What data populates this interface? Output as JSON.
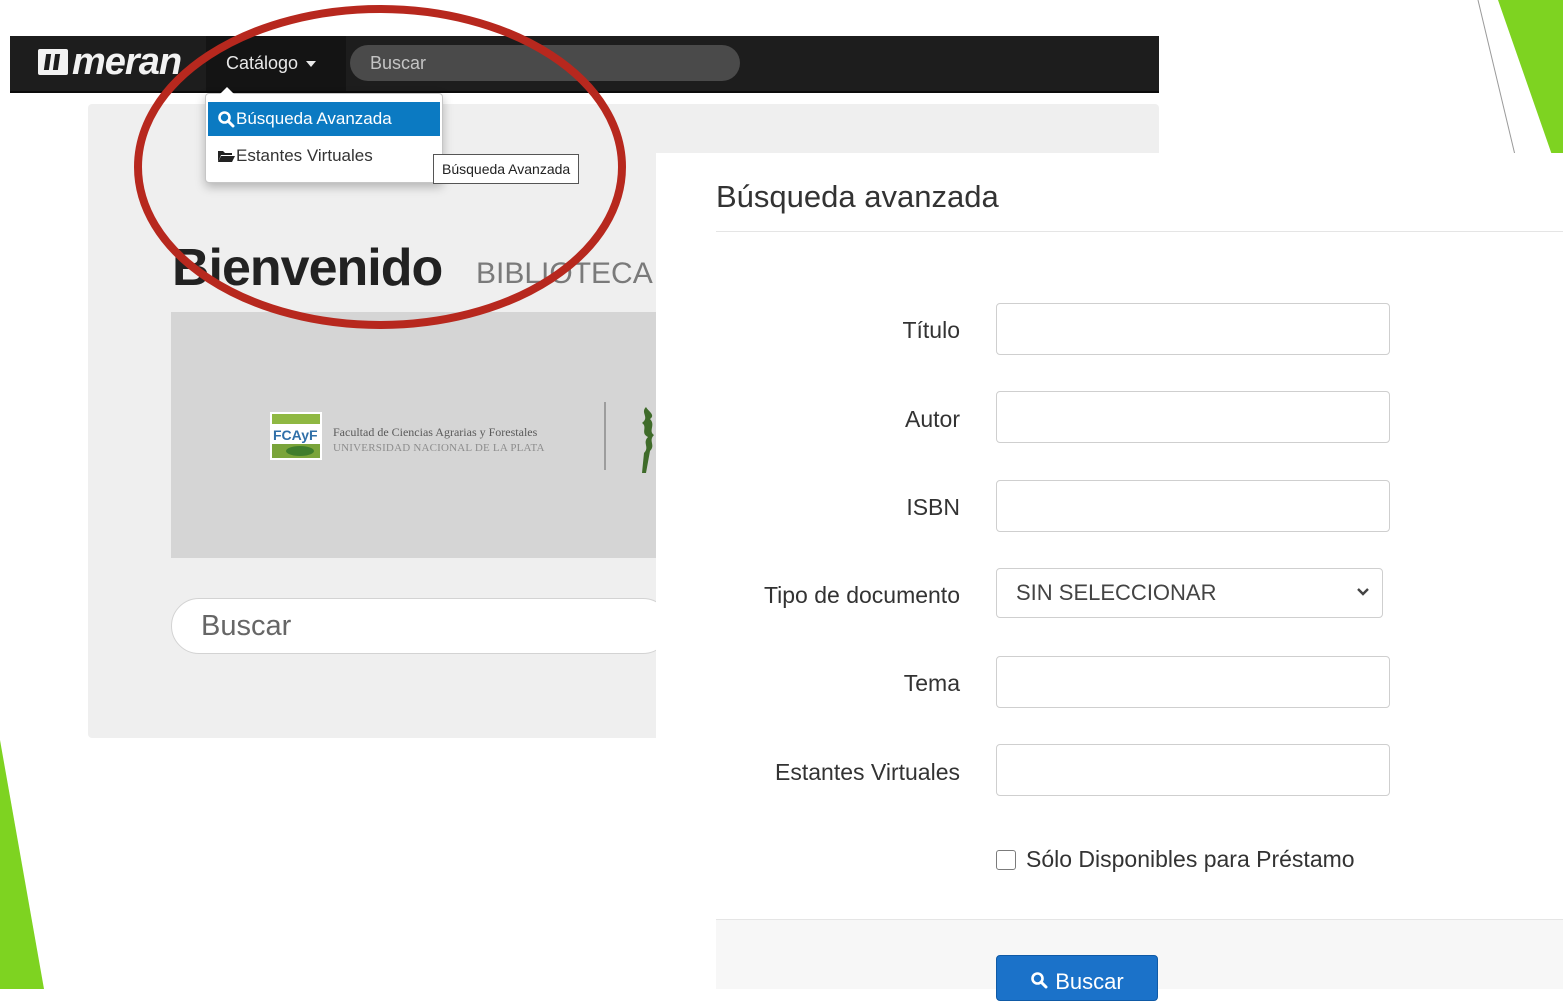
{
  "colors": {
    "navbar": "#1d1d1d",
    "accent_green": "#7ed321",
    "highlight_ellipse": "#b7281e",
    "dropdown_active": "#0b7ac2",
    "primary_button": "#1b72c9"
  },
  "navbar": {
    "logo_text": "meran",
    "catalog_label": "Catálogo",
    "search_placeholder": "Buscar"
  },
  "dropdown": {
    "items": [
      {
        "label": "Búsqueda Avanzada",
        "icon": "search-icon",
        "active": true
      },
      {
        "label": "Estantes Virtuales",
        "icon": "folder-open-icon",
        "active": false
      }
    ],
    "tooltip": "Búsqueda Avanzada"
  },
  "welcome": {
    "title": "Bienvenido",
    "subtitle": "BIBLIOTECA",
    "banner": {
      "logo_text": "FCAyF",
      "faculty_name": "Facultad de Ciencias Agrarias y Forestales",
      "university_name": "UNIVERSIDAD NACIONAL DE LA PLATA"
    },
    "search_placeholder": "Buscar"
  },
  "advanced_search": {
    "title": "Búsqueda avanzada",
    "fields": [
      {
        "label": "Título",
        "value": ""
      },
      {
        "label": "Autor",
        "value": ""
      },
      {
        "label": "ISBN",
        "value": ""
      },
      {
        "label": "Tipo de documento",
        "value": "SIN SELECCIONAR"
      },
      {
        "label": "Tema",
        "value": ""
      },
      {
        "label": "Estantes Virtuales",
        "value": ""
      }
    ],
    "checkbox_label": "Sólo Disponibles para Préstamo",
    "checkbox_checked": false,
    "submit_label": "Buscar"
  }
}
